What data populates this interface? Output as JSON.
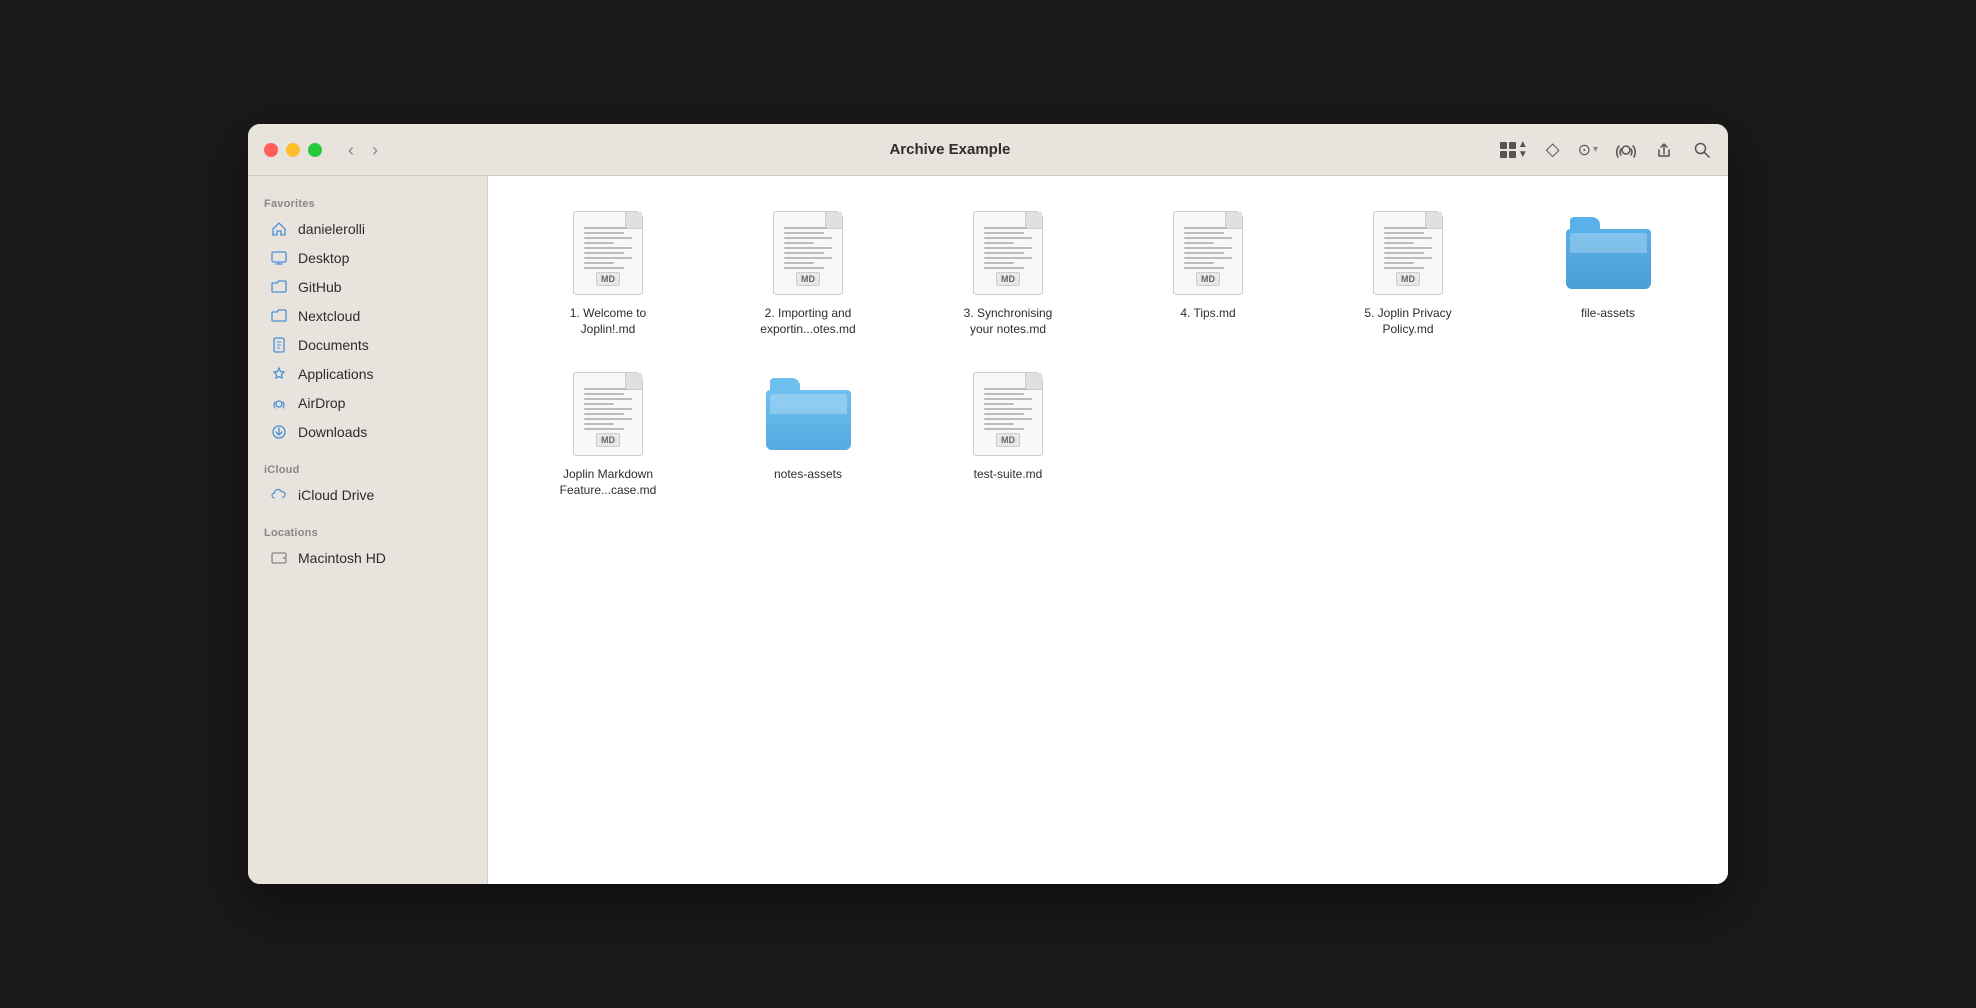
{
  "window": {
    "title": "Archive Example"
  },
  "trafficLights": {
    "close": "close",
    "minimize": "minimize",
    "maximize": "maximize"
  },
  "nav": {
    "back_label": "‹",
    "forward_label": "›"
  },
  "toolbar": {
    "tag_icon": "◇",
    "more_icon": "···",
    "airdrop_icon": "⊙",
    "share_icon": "↑",
    "search_icon": "⌕"
  },
  "sidebar": {
    "favorites_label": "Favorites",
    "icloud_label": "iCloud",
    "locations_label": "Locations",
    "items": [
      {
        "id": "danielerolli",
        "label": "danielerolli",
        "icon": "🏠",
        "icon_type": "blue"
      },
      {
        "id": "desktop",
        "label": "Desktop",
        "icon": "🖥",
        "icon_type": "blue"
      },
      {
        "id": "github",
        "label": "GitHub",
        "icon": "📁",
        "icon_type": "blue"
      },
      {
        "id": "nextcloud",
        "label": "Nextcloud",
        "icon": "📁",
        "icon_type": "blue"
      },
      {
        "id": "documents",
        "label": "Documents",
        "icon": "📄",
        "icon_type": "blue"
      },
      {
        "id": "applications",
        "label": "Applications",
        "icon": "🔧",
        "icon_type": "blue"
      },
      {
        "id": "airdrop",
        "label": "AirDrop",
        "icon": "📡",
        "icon_type": "blue"
      },
      {
        "id": "downloads",
        "label": "Downloads",
        "icon": "⬇",
        "icon_type": "blue"
      }
    ],
    "icloud_items": [
      {
        "id": "icloud-drive",
        "label": "iCloud Drive",
        "icon": "☁",
        "icon_type": "blue"
      }
    ],
    "location_items": [
      {
        "id": "macintosh-hd",
        "label": "Macintosh HD",
        "icon": "💿",
        "icon_type": "gray"
      }
    ]
  },
  "files": [
    {
      "id": "file1",
      "name": "1. Welcome to Joplin!.md",
      "type": "md"
    },
    {
      "id": "file2",
      "name": "2. Importing and exportin...otes.md",
      "type": "md"
    },
    {
      "id": "file3",
      "name": "3. Synchronising your notes.md",
      "type": "md"
    },
    {
      "id": "file4",
      "name": "4. Tips.md",
      "type": "md"
    },
    {
      "id": "file5",
      "name": "5. Joplin Privacy Policy.md",
      "type": "md"
    },
    {
      "id": "folder1",
      "name": "file-assets",
      "type": "folder-blue"
    },
    {
      "id": "file6",
      "name": "Joplin Markdown Feature...case.md",
      "type": "md"
    },
    {
      "id": "folder2",
      "name": "notes-assets",
      "type": "folder-light-blue"
    },
    {
      "id": "file7",
      "name": "test-suite.md",
      "type": "md"
    }
  ]
}
